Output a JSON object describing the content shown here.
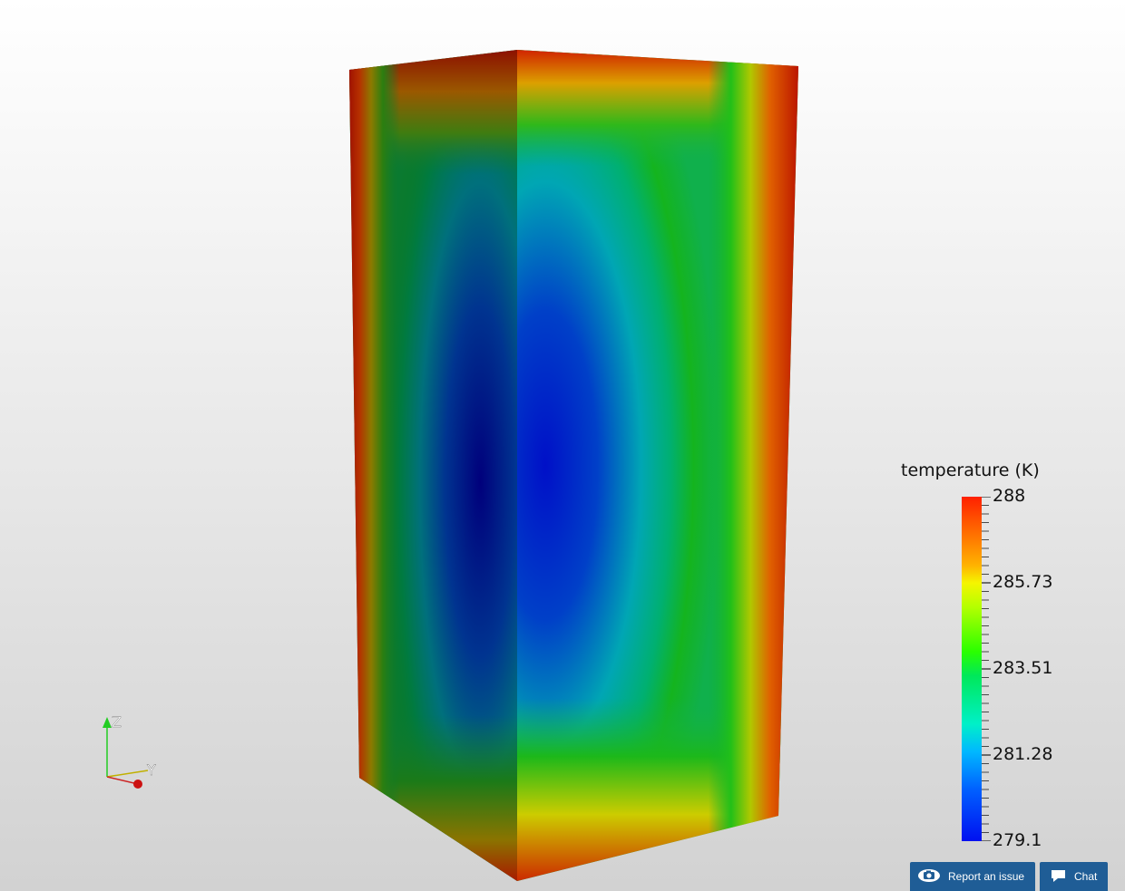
{
  "legend": {
    "title": "temperature (K)",
    "labels": [
      "288",
      "285.73",
      "283.51",
      "281.28",
      "279.1"
    ],
    "range": [
      279.1,
      288
    ]
  },
  "axes": {
    "z_label": "Z",
    "y_label": "Y"
  },
  "footer": {
    "report_label": "Report an issue",
    "chat_label": "Chat",
    "report_icon": "camera-icon",
    "chat_icon": "chat-bubble-icon"
  },
  "colors": {
    "button_bg": "#1f5d96",
    "hot": "#cc1b00",
    "cold": "#00009a"
  }
}
